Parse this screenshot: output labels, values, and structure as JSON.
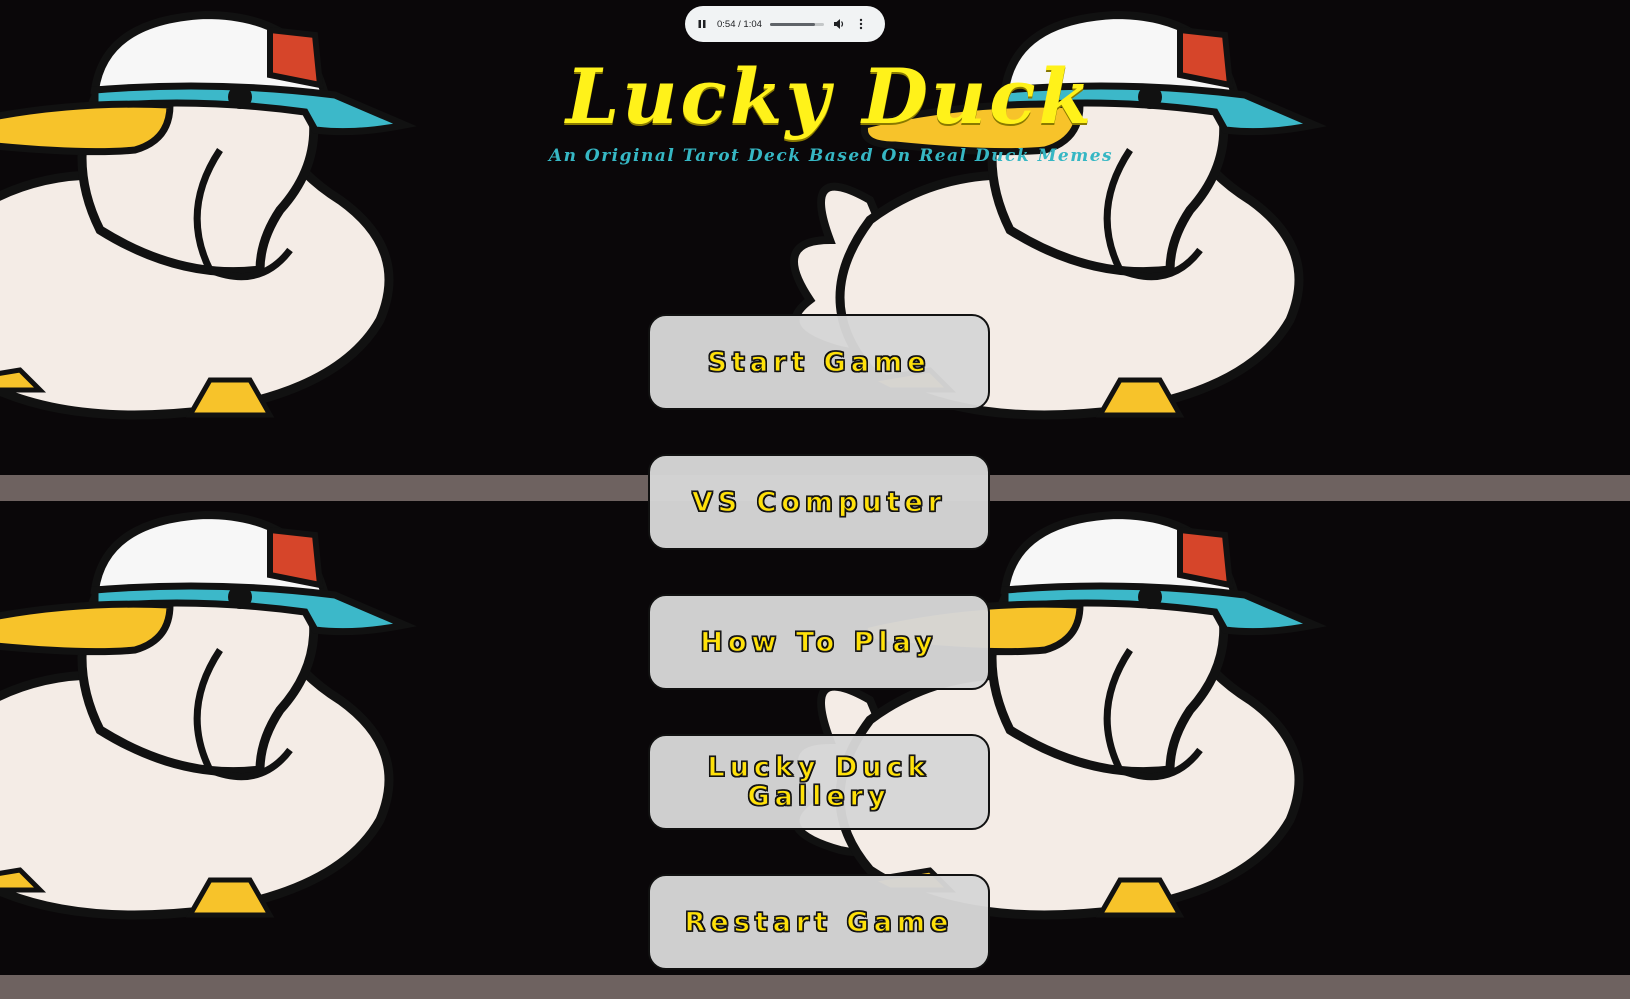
{
  "app": {
    "title": "Lucky Duck",
    "subtitle": "An Original Tarot Deck Based On Real Duck Memes"
  },
  "audio_player": {
    "state": "playing",
    "time_display": "0:54 / 1:04",
    "progress_fraction": 0.844,
    "icons": [
      "pause-icon",
      "volume-icon",
      "more-vert-icon"
    ]
  },
  "menu": {
    "items": [
      {
        "id": "start",
        "label": "Start Game"
      },
      {
        "id": "vs-computer",
        "label": "VS Computer"
      },
      {
        "id": "how-to-play",
        "label": "How To Play"
      },
      {
        "id": "gallery",
        "label": "Lucky Duck\nGallery"
      },
      {
        "id": "restart",
        "label": "Restart Game"
      }
    ]
  },
  "colors": {
    "title": "#fff21a",
    "subtitle": "#36b7c4",
    "button_text": "#ffe10a",
    "button_bg": "#d6d6d6",
    "background": "#0a0709"
  }
}
